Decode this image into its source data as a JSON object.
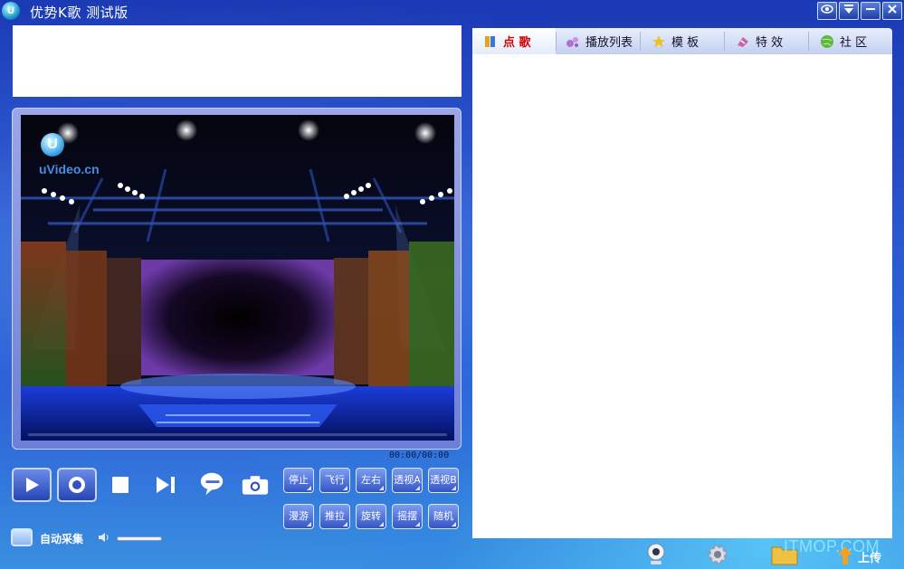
{
  "window": {
    "title": "优势K歌  测试版",
    "controls": [
      "skin",
      "menu",
      "minimize",
      "close"
    ]
  },
  "video": {
    "watermark_logo": "U",
    "watermark_text": "uVideo.cn",
    "time": "00:00/00:00"
  },
  "playback": {
    "buttons": [
      "play-icon",
      "record-icon",
      "stop-icon",
      "next-icon",
      "chat-icon",
      "camera-icon"
    ]
  },
  "effects": {
    "row1": [
      "停止",
      "飞行",
      "左右",
      "透视A",
      "透视B"
    ],
    "row2": [
      "漫游",
      "推拉",
      "旋转",
      "摇摆",
      "随机"
    ]
  },
  "capture": {
    "label": "自动采集",
    "volume": 1.0
  },
  "tabs": [
    {
      "label": "点 歌",
      "icon": "book-icon",
      "active": true
    },
    {
      "label": "播放列表",
      "icon": "bubbles-icon",
      "active": false
    },
    {
      "label": "模 板",
      "icon": "star-icon",
      "active": false
    },
    {
      "label": "特 效",
      "icon": "magic-icon",
      "active": false
    },
    {
      "label": "社 区",
      "icon": "globe-icon",
      "active": false
    }
  ],
  "bottom_bar": {
    "upload_label": "上传",
    "site_watermark": "ITMOP.COM"
  },
  "colors": {
    "active_tab_text": "#d40000",
    "app_background": "#1f3fb6"
  }
}
